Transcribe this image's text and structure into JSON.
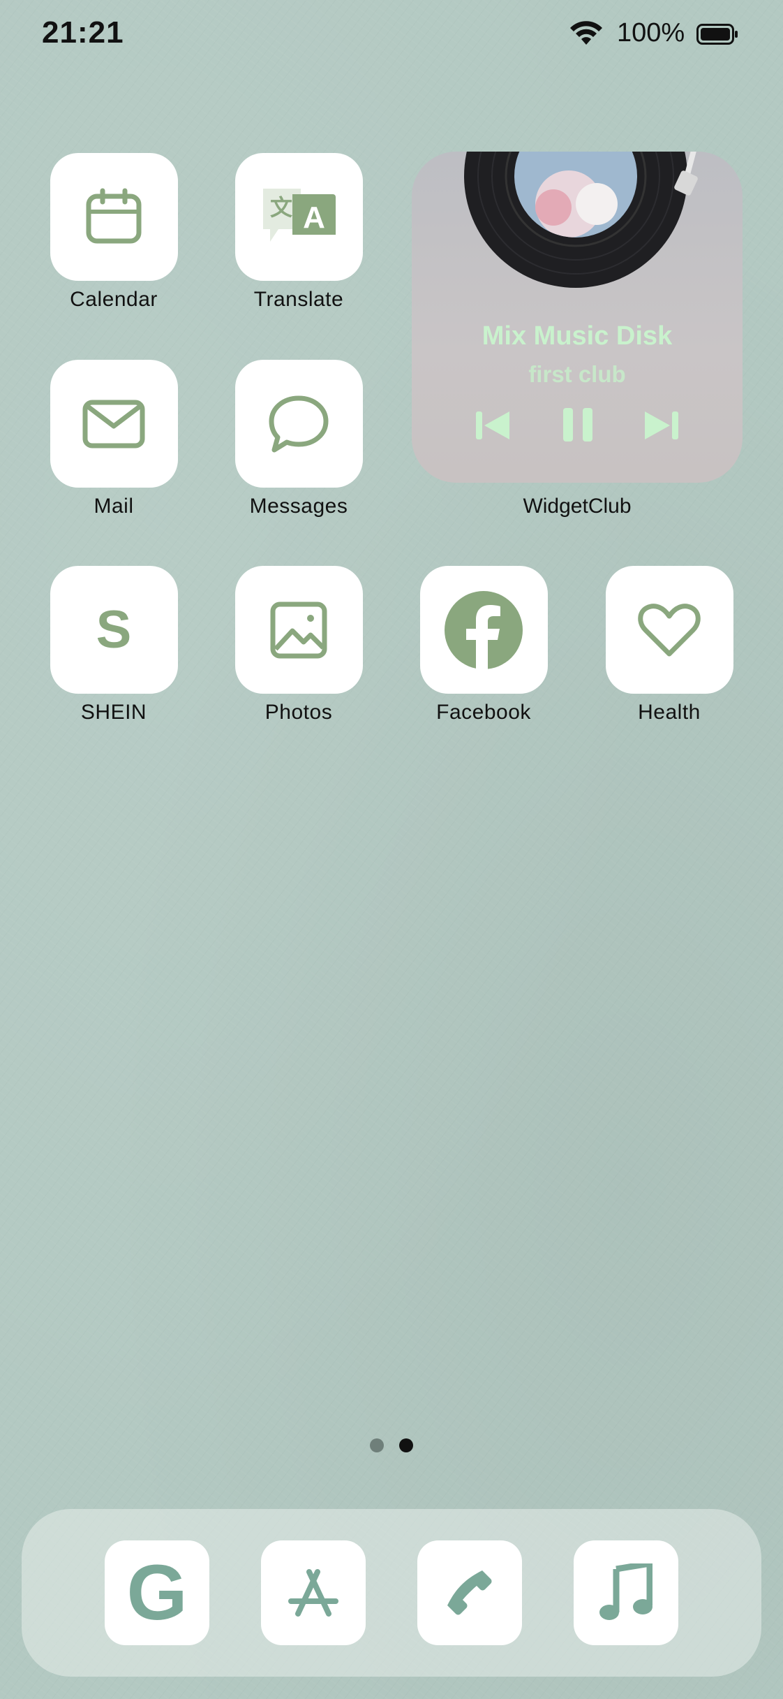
{
  "status_bar": {
    "time": "21:21",
    "battery_percent": "100%",
    "wifi_icon": "wifi-icon",
    "battery_icon": "battery-full-icon"
  },
  "apps": [
    {
      "label": "Calendar",
      "icon": "calendar-icon"
    },
    {
      "label": "Translate",
      "icon": "translate-icon"
    },
    {
      "label": "Mail",
      "icon": "mail-icon"
    },
    {
      "label": "Messages",
      "icon": "message-bubble-icon"
    },
    {
      "label": "SHEIN",
      "icon": "shein-letter-icon",
      "glyph": "S"
    },
    {
      "label": "Photos",
      "icon": "photo-icon"
    },
    {
      "label": "Facebook",
      "icon": "facebook-icon"
    },
    {
      "label": "Health",
      "icon": "heart-icon"
    }
  ],
  "widget": {
    "title": "Mix Music Disk",
    "subtitle": "first club",
    "label": "WidgetClub",
    "controls": [
      "previous-icon",
      "pause-icon",
      "next-icon"
    ]
  },
  "page_indicator": {
    "pages": 2,
    "current": 2
  },
  "dock": [
    {
      "name": "google",
      "icon": "google-g-icon",
      "glyph": "G"
    },
    {
      "name": "app-store",
      "icon": "app-store-icon"
    },
    {
      "name": "phone",
      "icon": "phone-icon"
    },
    {
      "name": "music",
      "icon": "music-note-icon"
    }
  ],
  "colors": {
    "icon_green": "#8aa77e",
    "dock_icon_green": "#7ba898",
    "widget_text": "#c9f2cd",
    "background": "#b3c9c2"
  }
}
